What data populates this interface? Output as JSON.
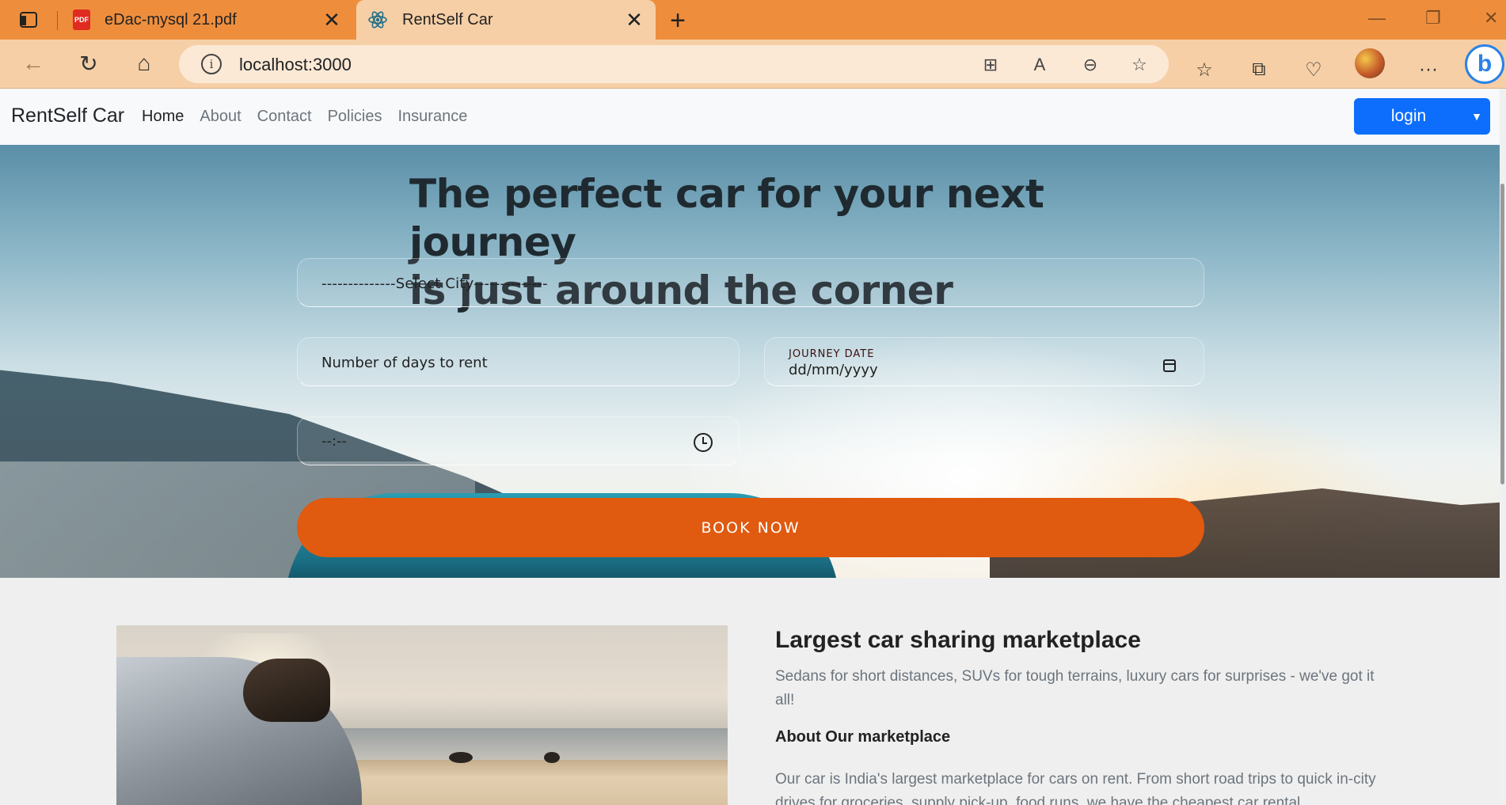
{
  "browser": {
    "tabs": [
      {
        "title": "eDac-mysql 21.pdf",
        "icon": "pdf-icon",
        "active": false
      },
      {
        "title": "RentSelf Car",
        "icon": "react-icon",
        "active": true
      }
    ],
    "address": "localhost:3000",
    "colors": {
      "tabbar": "#ee8e3d",
      "toolbar": "#f6cfa6"
    }
  },
  "navbar": {
    "brand": "RentSelf Car",
    "links": [
      {
        "label": "Home",
        "active": true
      },
      {
        "label": "About",
        "active": false
      },
      {
        "label": "Contact",
        "active": false
      },
      {
        "label": "Policies",
        "active": false
      },
      {
        "label": "Insurance",
        "active": false
      }
    ],
    "login_label": "login",
    "login_color": "#0d6efd"
  },
  "hero": {
    "title_line1": "The perfect car for your next journey",
    "title_line2": "is just around the corner",
    "city_select": "--------------Select City--------------",
    "days_placeholder": "Number of days to rent",
    "journey_date_label": "JOURNEY DATE",
    "journey_date_value": "dd/mm/yyyy",
    "time_value": "--:--",
    "book_label": "BOOK NOW",
    "book_color": "#e05a0f"
  },
  "marketplace": {
    "title": "Largest car sharing marketplace",
    "description": "Sedans for short distances, SUVs for tough terrains, luxury cars for surprises - we've got it all!",
    "about_title": "About Our marketplace",
    "about_text": "Our car is India's largest marketplace for cars on rent. From short road trips to quick in-city drives for groceries, supply pick-up, food runs, we have the cheapest car rental"
  }
}
